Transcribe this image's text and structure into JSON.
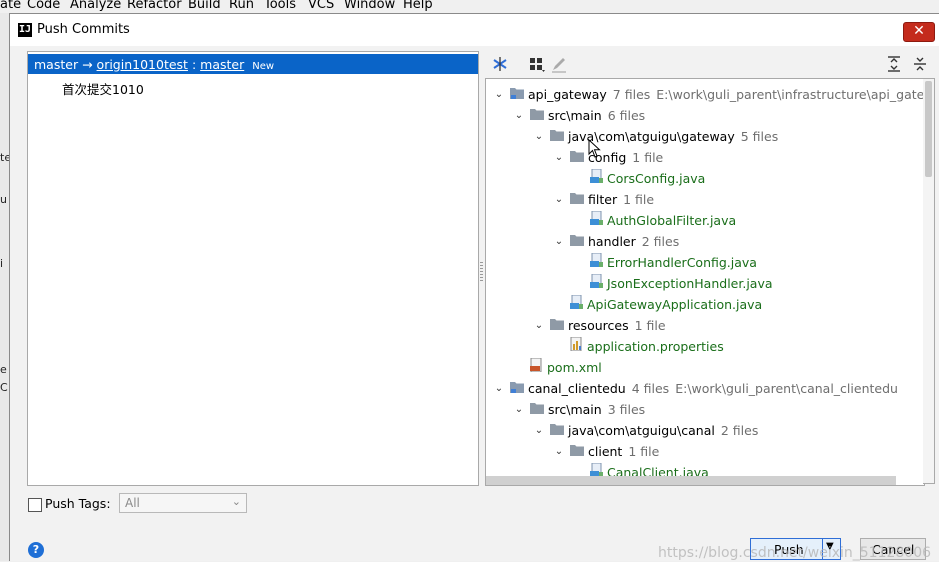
{
  "menubar": [
    "ate",
    "Code",
    "Analyze",
    "Refactor",
    "Build",
    "Run",
    "Tools",
    "VCS",
    "Window",
    "Help"
  ],
  "dialog": {
    "title": "Push Commits",
    "close_label": "✕"
  },
  "commits": {
    "branch_local": "master",
    "arrow": "→",
    "remote": "origin1010test",
    "colon": ":",
    "branch_remote": "master",
    "badge": "New",
    "message": "首次提交1010"
  },
  "tree": [
    {
      "level": 0,
      "expanded": true,
      "icon": "module-icon",
      "name": "api_gateway",
      "count": "7 files",
      "path": "E:\\work\\guli_parent\\infrastructure\\api_gateway"
    },
    {
      "level": 1,
      "expanded": true,
      "icon": "folder-icon",
      "name": "src\\main",
      "count": "6 files"
    },
    {
      "level": 2,
      "expanded": true,
      "icon": "folder-icon",
      "name": "java\\com\\atguigu\\gateway",
      "count": "5 files"
    },
    {
      "level": 3,
      "expanded": true,
      "icon": "folder-icon",
      "name": "config",
      "count": "1 file"
    },
    {
      "level": 4,
      "icon": "java-file-icon",
      "name": "CorsConfig.java",
      "green": true
    },
    {
      "level": 3,
      "expanded": true,
      "icon": "folder-icon",
      "name": "filter",
      "count": "1 file"
    },
    {
      "level": 4,
      "icon": "java-file-icon",
      "name": "AuthGlobalFilter.java",
      "green": true
    },
    {
      "level": 3,
      "expanded": true,
      "icon": "folder-icon",
      "name": "handler",
      "count": "2 files"
    },
    {
      "level": 4,
      "icon": "java-file-icon",
      "name": "ErrorHandlerConfig.java",
      "green": true
    },
    {
      "level": 4,
      "icon": "java-file-icon",
      "name": "JsonExceptionHandler.java",
      "green": true
    },
    {
      "level": 3,
      "icon": "java-file-icon",
      "name": "ApiGatewayApplication.java",
      "green": true
    },
    {
      "level": 2,
      "expanded": true,
      "icon": "folder-icon",
      "name": "resources",
      "count": "1 file"
    },
    {
      "level": 3,
      "icon": "properties-file-icon",
      "name": "application.properties",
      "green": true
    },
    {
      "level": 1,
      "icon": "maven-file-icon",
      "name": "pom.xml",
      "green": true
    },
    {
      "level": 0,
      "expanded": true,
      "icon": "module-icon",
      "name": "canal_clientedu",
      "count": "4 files",
      "path": "E:\\work\\guli_parent\\canal_clientedu"
    },
    {
      "level": 1,
      "expanded": true,
      "icon": "folder-icon",
      "name": "src\\main",
      "count": "3 files"
    },
    {
      "level": 2,
      "expanded": true,
      "icon": "folder-icon",
      "name": "java\\com\\atguigu\\canal",
      "count": "2 files"
    },
    {
      "level": 3,
      "expanded": true,
      "icon": "folder-icon",
      "name": "client",
      "count": "1 file"
    },
    {
      "level": 4,
      "icon": "java-file-icon",
      "name": "CanalClient.java",
      "green": true
    }
  ],
  "footer": {
    "push_tags_label": "Push Tags:",
    "tags_select_value": "All",
    "push_label": "Push",
    "cancel_label": "Cancel",
    "help_label": "?",
    "watermark": "https://blog.csdn.net/weixin_51128006"
  },
  "colors": {
    "selection": "#0a64c8",
    "file_green": "#1a6e1a",
    "close_red": "#c42b1c"
  }
}
